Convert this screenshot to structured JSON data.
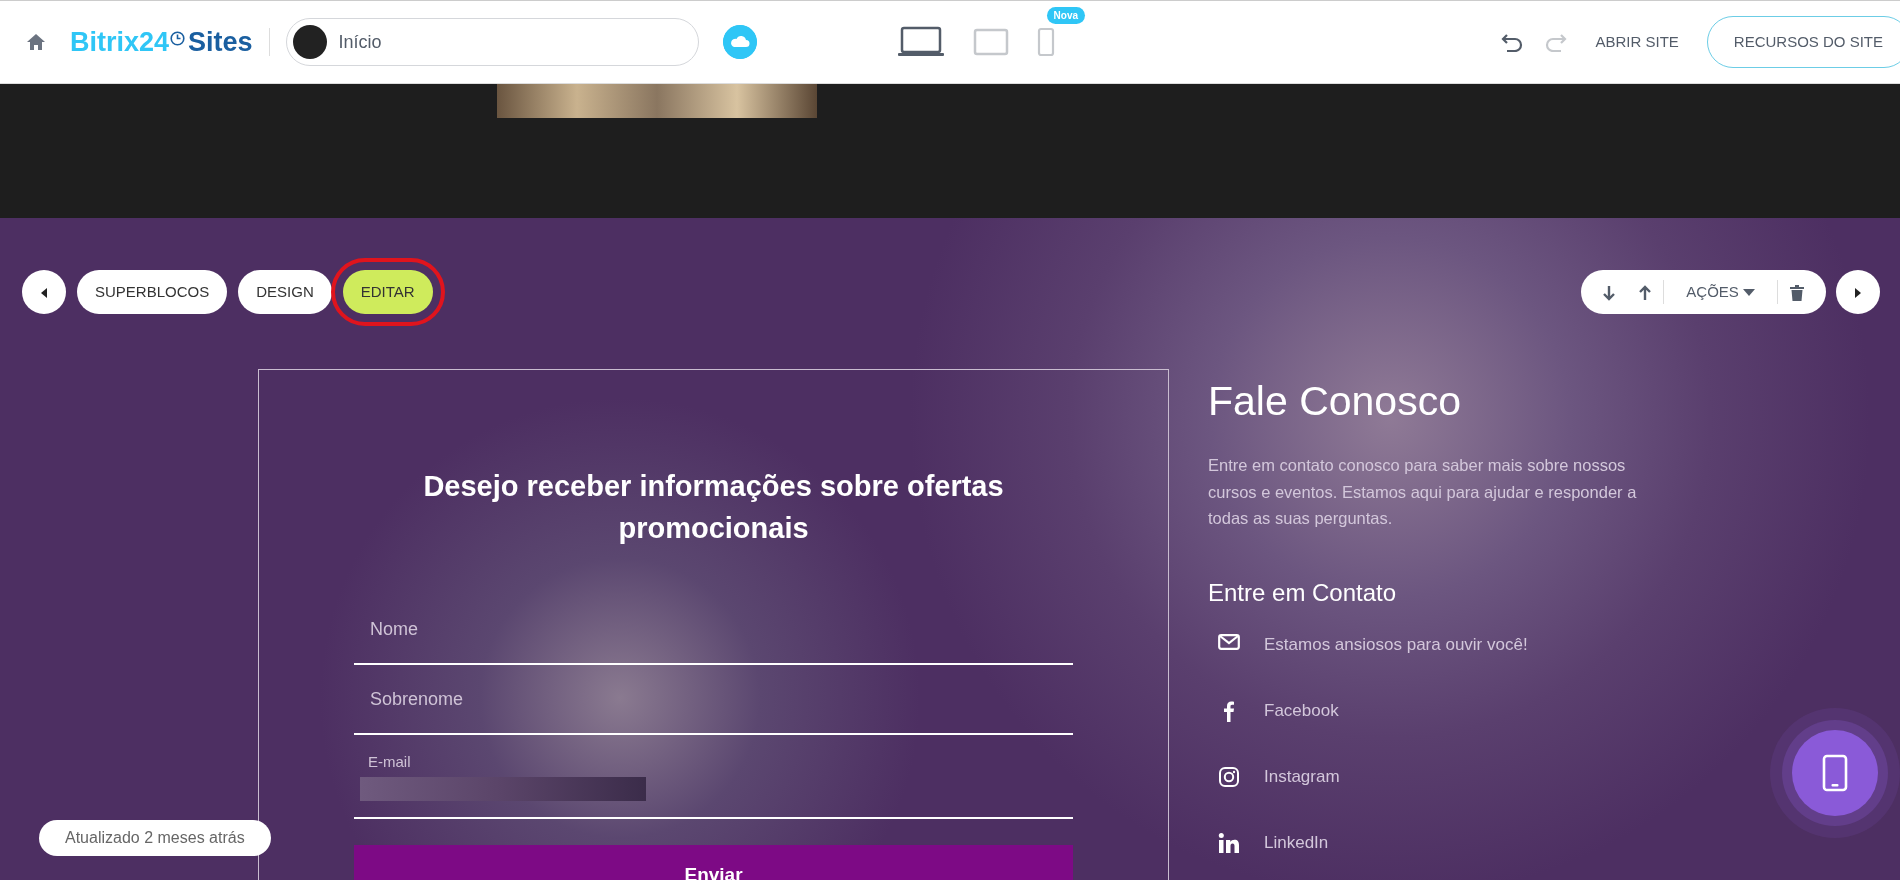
{
  "header": {
    "logo_brand": "Bitrix24",
    "logo_suffix": "Sites",
    "page_selector": "Início",
    "devices": [
      {
        "kind": "desktop",
        "selected": true
      },
      {
        "kind": "tablet",
        "selected": false
      },
      {
        "kind": "mobile",
        "selected": false,
        "badge": "Nova"
      }
    ],
    "redo_disabled": true,
    "open_site": "ABRIR SITE",
    "site_resources": "RECURSOS DO SITE"
  },
  "block_toolbar": {
    "tabs": [
      {
        "label": "SUPERBLOCOS",
        "selected": false,
        "highlighted": false
      },
      {
        "label": "DESIGN",
        "selected": false,
        "highlighted": false
      },
      {
        "label": "EDITAR",
        "selected": true,
        "highlighted": true
      }
    ],
    "actions": "AÇÕES"
  },
  "form": {
    "title": "Desejo receber informações sobre ofertas promocionais",
    "fields": [
      {
        "kind": "plain",
        "placeholder": "Nome"
      },
      {
        "kind": "plain",
        "placeholder": "Sobrenome"
      },
      {
        "kind": "redacted",
        "label": "E-mail"
      }
    ],
    "submit": "Enviar"
  },
  "contact": {
    "title": "Fale Conosco",
    "intro": "Entre em contato conosco para saber mais sobre nossos cursos e eventos. Estamos aqui para ajudar e responder a todas as suas perguntas.",
    "subtitle": "Entre em Contato",
    "items": [
      {
        "kind": "email",
        "text": "Estamos ansiosos para ouvir você!"
      },
      {
        "kind": "facebook",
        "text": "Facebook"
      },
      {
        "kind": "instagram",
        "text": "Instagram"
      },
      {
        "kind": "linkedin",
        "text": "LinkedIn"
      }
    ]
  },
  "status": "Atualizado 2 meses atrás"
}
